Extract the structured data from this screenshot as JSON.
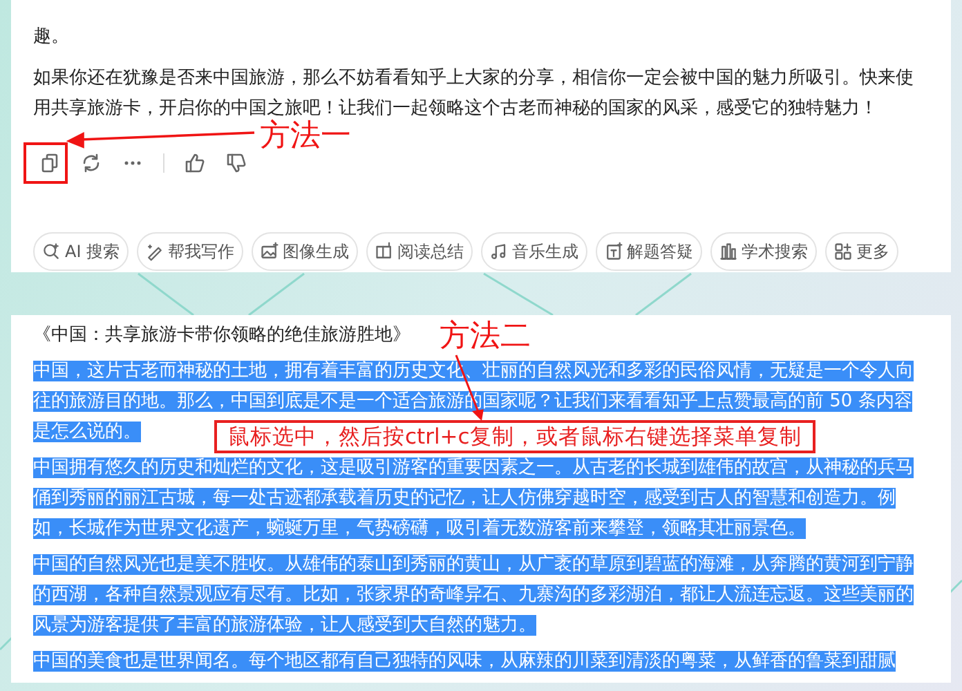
{
  "answer": {
    "paragraphs": [
      "趣。",
      "如果你还在犹豫是否来中国旅游，那么不妨看看知乎上大家的分享，相信你一定会被中国的魅力所吸引。快来使用共享旅游卡，开启你的中国之旅吧！让我们一起领略这个古老而神秘的国家的风采，感受它的独特魅力！"
    ]
  },
  "tools": [
    {
      "kind": "search",
      "label": "AI 搜索"
    },
    {
      "kind": "write",
      "label": "帮我写作"
    },
    {
      "kind": "image",
      "label": "图像生成"
    },
    {
      "kind": "read",
      "label": "阅读总结"
    },
    {
      "kind": "music",
      "label": "音乐生成"
    },
    {
      "kind": "solve",
      "label": "解题答疑"
    },
    {
      "kind": "academic",
      "label": "学术搜索"
    },
    {
      "kind": "more",
      "label": "更多"
    }
  ],
  "article": {
    "title": "《中国：共享旅游卡带你领略的绝佳旅游胜地》",
    "paragraphs": [
      {
        "text": "中国，这片古老而神秘的土地，拥有着丰富的历史文化、壮丽的自然风光和多彩的民俗风情，无疑是一个令人向往的旅游目的地。那么，中国到底是不是一个适合旅游的国家呢？让我们来看看知乎上点赞最高的前 50 条内容是怎么说的。",
        "selected": true
      },
      {
        "text": "中国拥有悠久的历史和灿烂的文化，这是吸引游客的重要因素之一。从古老的长城到雄伟的故宫，从神秘的兵马俑到秀丽的丽江古城，每一处古迹都承载着历史的记忆，让人仿佛穿越时空，感受到古人的智慧和创造力。例如，长城作为世界文化遗产，蜿蜒万里，气势磅礴，吸引着无数游客前来攀登，领略其壮丽景色。",
        "selected": true
      },
      {
        "text": "中国的自然风光也是美不胜收。从雄伟的泰山到秀丽的黄山，从广袤的草原到碧蓝的海滩，从奔腾的黄河到宁静的西湖，各种自然景观应有尽有。比如，张家界的奇峰异石、九寨沟的多彩湖泊，都让人流连忘返。这些美丽的风景为游客提供了丰富的旅游体验，让人感受到大自然的魅力。",
        "selected": true
      },
      {
        "text": "中国的美食也是世界闻名。每个地区都有自己独特的风味，从麻辣的川菜到清淡的粤菜，从鲜香的鲁菜到甜腻",
        "selected": true
      }
    ]
  },
  "annotations": {
    "method_one": "方法一",
    "method_two": "方法二",
    "instruction": "鼠标选中，然后按ctrl+c复制，或者鼠标右键选择菜单复制"
  }
}
